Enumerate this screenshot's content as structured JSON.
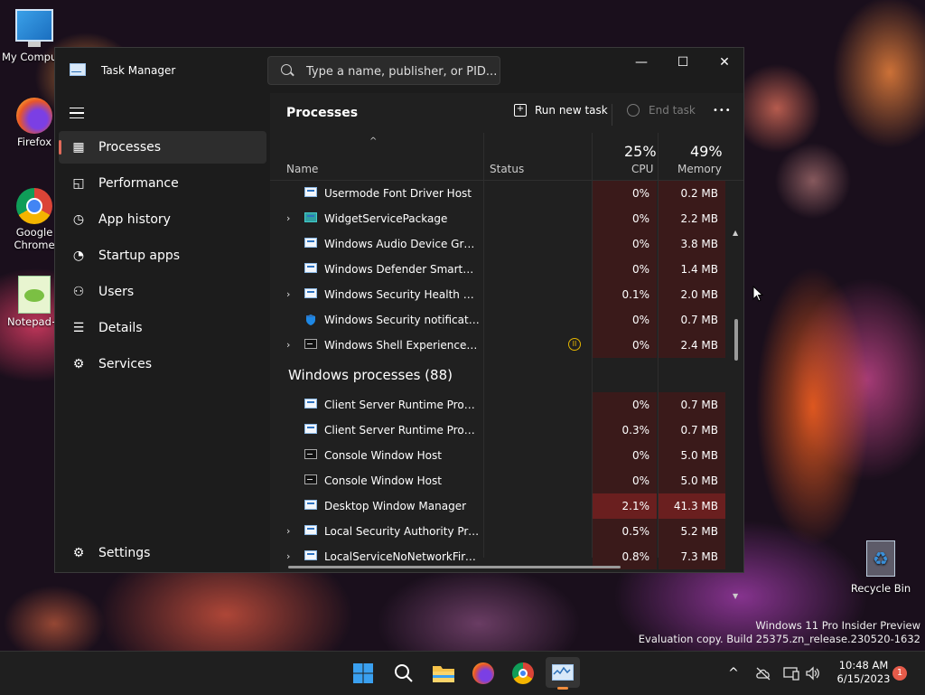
{
  "desktop": {
    "icons": [
      {
        "label": "My Computer"
      },
      {
        "label": "Firefox"
      },
      {
        "label": "Google Chrome"
      },
      {
        "label": "Notepad++"
      },
      {
        "label": "Recycle Bin"
      }
    ],
    "watermark": {
      "line1": "Windows 11 Pro Insider Preview",
      "line2": "Evaluation copy. Build 25375.zn_release.230520-1632"
    }
  },
  "window": {
    "title": "Task Manager",
    "search_placeholder": "Type a name, publisher, or PID...",
    "controls": {
      "minimize": "—",
      "maximize": "☐",
      "close": "✕"
    }
  },
  "sidebar": {
    "items": [
      {
        "label": "Processes",
        "icon": "processes-icon"
      },
      {
        "label": "Performance",
        "icon": "performance-icon"
      },
      {
        "label": "App history",
        "icon": "history-icon"
      },
      {
        "label": "Startup apps",
        "icon": "startup-icon"
      },
      {
        "label": "Users",
        "icon": "users-icon"
      },
      {
        "label": "Details",
        "icon": "details-icon"
      },
      {
        "label": "Services",
        "icon": "services-icon"
      }
    ],
    "settings": "Settings"
  },
  "main": {
    "title": "Processes",
    "run_new_task": "Run new task",
    "end_task": "End task",
    "more": "•••",
    "columns": {
      "name": "Name",
      "status": "Status",
      "cpu_pct": "25%",
      "cpu": "CPU",
      "mem_pct": "49%",
      "memory": "Memory"
    },
    "rows": [
      {
        "name": "Usermode Font Driver Host",
        "cpu": "0%",
        "mem": "0.2 MB"
      },
      {
        "name": "WidgetServicePackage",
        "cpu": "0%",
        "mem": "2.2 MB"
      },
      {
        "name": "Windows Audio Device Graph ...",
        "cpu": "0%",
        "mem": "3.8 MB"
      },
      {
        "name": "Windows Defender SmartScreen",
        "cpu": "0%",
        "mem": "1.4 MB"
      },
      {
        "name": "Windows Security Health Servi...",
        "cpu": "0.1%",
        "mem": "2.0 MB"
      },
      {
        "name": "Windows Security notification...",
        "cpu": "0%",
        "mem": "0.7 MB"
      },
      {
        "name": "Windows Shell Experience Ho...",
        "cpu": "0%",
        "mem": "2.4 MB"
      }
    ],
    "group": "Windows processes (88)",
    "rows2": [
      {
        "name": "Client Server Runtime Process",
        "cpu": "0%",
        "mem": "0.7 MB"
      },
      {
        "name": "Client Server Runtime Process",
        "cpu": "0.3%",
        "mem": "0.7 MB"
      },
      {
        "name": "Console Window Host",
        "cpu": "0%",
        "mem": "5.0 MB"
      },
      {
        "name": "Console Window Host",
        "cpu": "0%",
        "mem": "5.0 MB"
      },
      {
        "name": "Desktop Window Manager",
        "cpu": "2.1%",
        "mem": "41.3 MB"
      },
      {
        "name": "Local Security Authority Proce...",
        "cpu": "0.5%",
        "mem": "5.2 MB"
      },
      {
        "name": "LocalServiceNoNetworkFirewa...",
        "cpu": "0.8%",
        "mem": "7.3 MB"
      }
    ]
  },
  "taskbar": {
    "time": "10:48 AM",
    "date": "6/15/2023",
    "notification_count": "1"
  }
}
